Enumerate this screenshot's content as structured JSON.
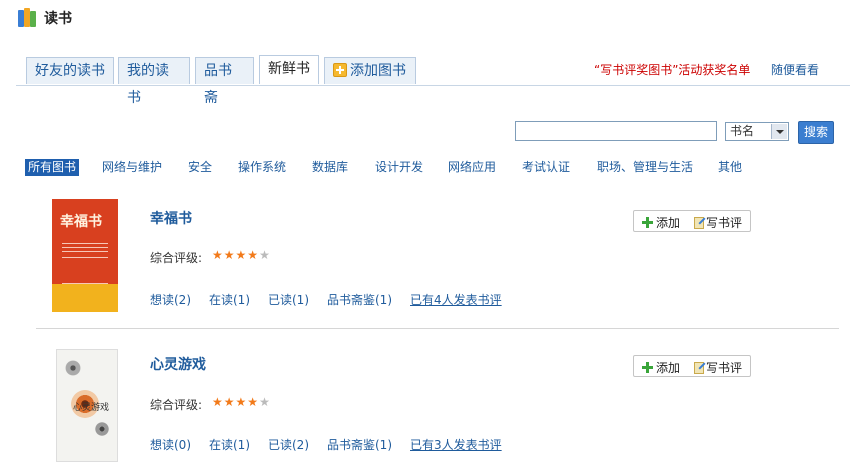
{
  "app": {
    "title": "读书"
  },
  "tabs": [
    {
      "label": "好友的读书",
      "active": false
    },
    {
      "label": "我的读书",
      "active": false
    },
    {
      "label": "品书斋",
      "active": false
    },
    {
      "label": "新鲜书",
      "active": true
    },
    {
      "label": "添加图书",
      "active": false
    }
  ],
  "header_links": {
    "award": "“写书评奖图书”活动获奖名单",
    "random": "随便看看"
  },
  "search": {
    "value": "",
    "select_value": "书名",
    "button_label": "搜索"
  },
  "categories": [
    "所有图书",
    "网络与维护",
    "安全",
    "操作系统",
    "数据库",
    "设计开发",
    "网络应用",
    "考试认证",
    "职场、管理与生活",
    "其他"
  ],
  "books": [
    {
      "title": "幸福书",
      "cover_text": "幸福书",
      "rating_label": "综合评级:",
      "rating": 4,
      "stats": {
        "want": "想读(2)",
        "reading": "在读(1)",
        "read": "已读(1)",
        "appraisal": "品书斋鉴(1)",
        "reviews": "已有4人发表书评"
      },
      "actions": {
        "add": "添加",
        "review": "写书评"
      }
    },
    {
      "title": "心灵游戏",
      "cover_text": "心灵游戏",
      "rating_label": "综合评级:",
      "rating": 4,
      "stats": {
        "want": "想读(0)",
        "reading": "在读(1)",
        "read": "已读(2)",
        "appraisal": "品书斋鉴(1)",
        "reviews": "已有3人发表书评"
      },
      "actions": {
        "add": "添加",
        "review": "写书评"
      }
    }
  ],
  "colors": {
    "link": "#1f5b9c",
    "award": "#cc0000",
    "star": "#f27a1a",
    "active_category": "#1f5fae"
  }
}
